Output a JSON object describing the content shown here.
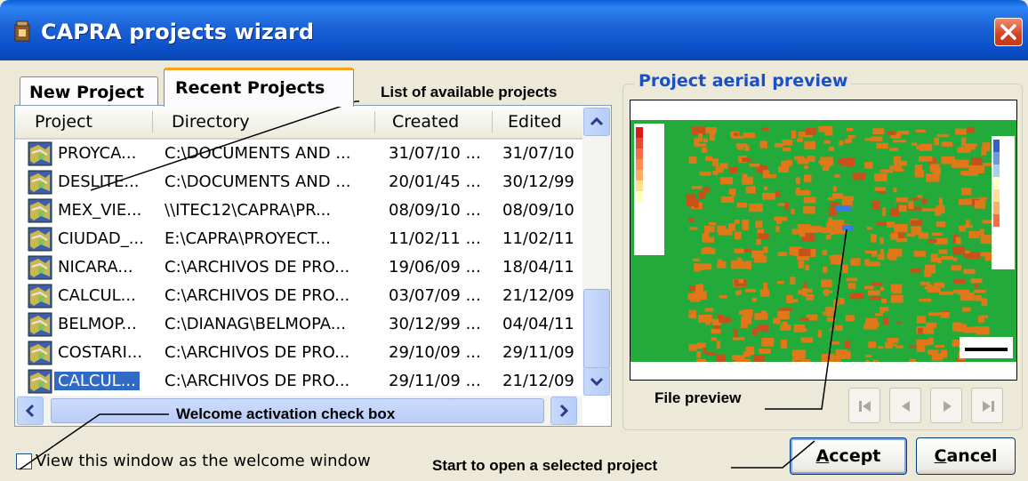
{
  "window": {
    "title": "CAPRA projects wizard",
    "title_icon": "capra-app-icon",
    "close_icon": "close-icon"
  },
  "tabs": [
    {
      "label": "New Project",
      "active": false
    },
    {
      "label": "Recent Projects",
      "active": true
    }
  ],
  "project_list": {
    "columns": [
      "Project",
      "Directory",
      "Created",
      "Edited"
    ],
    "rows": [
      {
        "project": "PROYCA...",
        "directory": "C:\\DOCUMENTS AND ...",
        "created": "31/07/10 ...",
        "edited": "31/07/10"
      },
      {
        "project": "DESLITE...",
        "directory": "C:\\DOCUMENTS AND ...",
        "created": "20/01/45 ...",
        "edited": "30/12/99"
      },
      {
        "project": "MEX_VIE...",
        "directory": "\\\\ITEC12\\CAPRA\\PR...",
        "created": "08/09/10 ...",
        "edited": "08/09/10"
      },
      {
        "project": "CIUDAD_...",
        "directory": "E:\\CAPRA\\PROYECT...",
        "created": "11/02/11 ...",
        "edited": "11/02/11"
      },
      {
        "project": "NICARA...",
        "directory": "C:\\ARCHIVOS DE PRO...",
        "created": "19/06/09 ...",
        "edited": "18/04/11"
      },
      {
        "project": "CALCUL...",
        "directory": "C:\\ARCHIVOS DE PRO...",
        "created": "03/07/09 ...",
        "edited": "21/12/09"
      },
      {
        "project": "BELMOP...",
        "directory": "C:\\DIANAG\\BELMOPA...",
        "created": "30/12/99 ...",
        "edited": "04/04/11"
      },
      {
        "project": "COSTARI...",
        "directory": "C:\\ARCHIVOS DE PRO...",
        "created": "29/10/09 ...",
        "edited": "29/11/09"
      },
      {
        "project": "CALCUL...",
        "directory": "C:\\ARCHIVOS DE PRO...",
        "created": "29/11/09 ...",
        "edited": "21/12/09",
        "selected": true
      }
    ]
  },
  "preview": {
    "title": "Project aerial preview",
    "nav_icons": [
      "first-icon",
      "previous-icon",
      "next-icon",
      "last-icon"
    ]
  },
  "checkbox": {
    "label": "View this window as the welcome window",
    "checked": false
  },
  "buttons": {
    "accept_rest": "ccept",
    "accept_key": "A",
    "cancel_rest": "ancel",
    "cancel_key": "C"
  },
  "annotations": {
    "list": "List of available projects",
    "welcome": "Welcome activation check box",
    "file_preview": "File preview",
    "start": "Start to open a selected project"
  },
  "colors": {
    "titlebar": "#0b4fc7",
    "tab_highlight": "#f4a21b",
    "selection": "#316ac5",
    "map_ground": "#22aa3a",
    "buildings": "#e0781a"
  }
}
